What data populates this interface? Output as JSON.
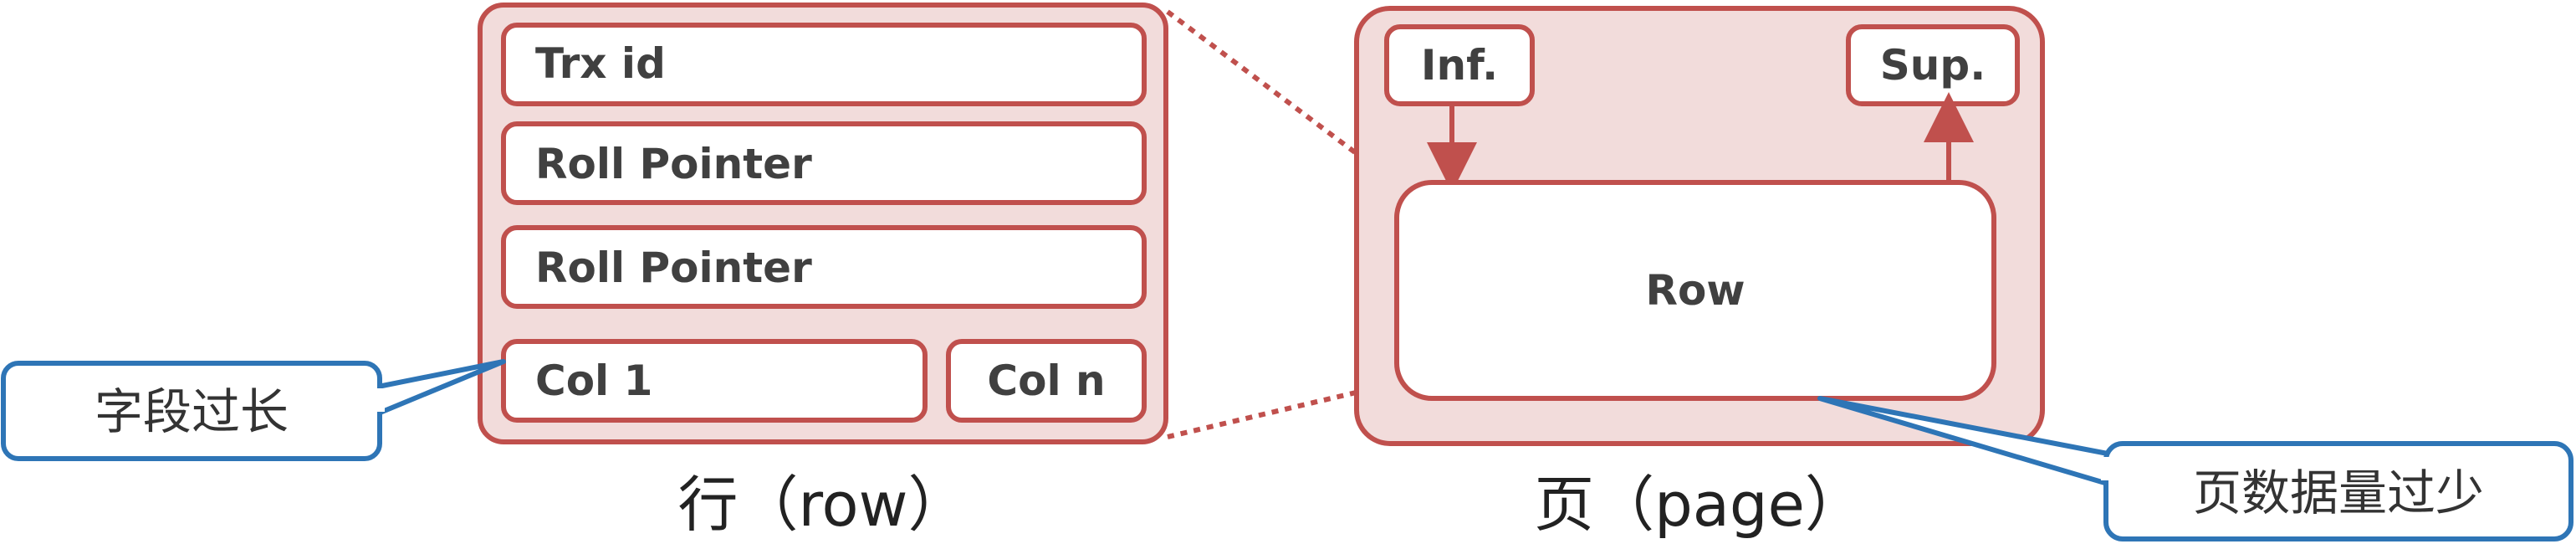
{
  "row": {
    "fields": {
      "trx_id": "Trx id",
      "roll_pointer_1": "Roll Pointer",
      "roll_pointer_2": "Roll Pointer",
      "col_1": "Col 1",
      "col_n": "Col n"
    },
    "caption": "行（row）",
    "callout": "字段过长"
  },
  "page": {
    "infimum": "Inf.",
    "supremum": "Sup.",
    "row": "Row",
    "caption": "页（page）",
    "callout": "页数据量过少"
  },
  "colors": {
    "container_fill": "#f2dcdb",
    "container_stroke": "#c0504d",
    "box_fill": "#ffffff",
    "callout_stroke": "#2e75b6",
    "label_text": "#404040"
  }
}
